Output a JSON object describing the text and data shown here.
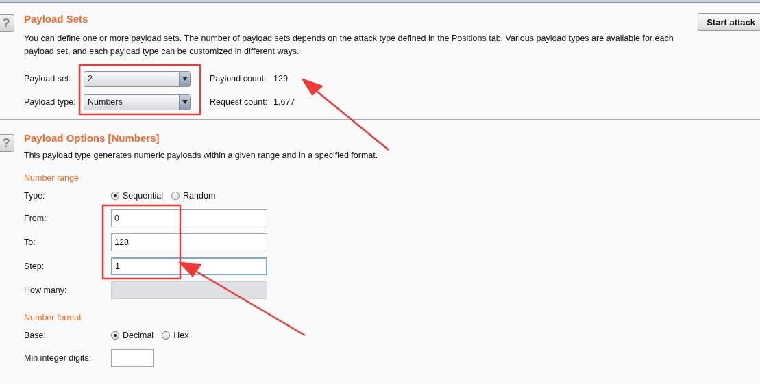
{
  "payload_sets": {
    "help_icon": "?",
    "title": "Payload Sets",
    "description": "You can define one or more payload sets. The number of payload sets depends on the attack type defined in the Positions tab. Various payload types are available for each payload set, and each payload type can be customized in different ways.",
    "start_button": "Start attack",
    "rows": [
      {
        "label": "Payload set:",
        "value": "2",
        "count_label": "Payload count:",
        "count": "129"
      },
      {
        "label": "Payload type:",
        "value": "Numbers",
        "count_label": "Request count:",
        "count": "1,677"
      }
    ]
  },
  "payload_options": {
    "help_icon": "?",
    "title": "Payload Options [Numbers]",
    "description": "This payload type generates numeric payloads within a given range and in a specified format.",
    "groups": [
      {
        "heading": "Number range",
        "rows": [
          {
            "kind": "radio",
            "label": "Type:",
            "options": [
              {
                "label": "Sequential",
                "selected": true
              },
              {
                "label": "Random",
                "selected": false
              }
            ]
          },
          {
            "kind": "input",
            "label": "From:",
            "value": "0",
            "focused": false,
            "disabled": false
          },
          {
            "kind": "input",
            "label": "To:",
            "value": "128",
            "focused": false,
            "disabled": false
          },
          {
            "kind": "input",
            "label": "Step:",
            "value": "1",
            "focused": true,
            "disabled": false
          },
          {
            "kind": "input",
            "label": "How many:",
            "focused": false,
            "disabled": true
          }
        ]
      },
      {
        "heading": "Number format",
        "rows": [
          {
            "kind": "radio",
            "label": "Base:",
            "options": [
              {
                "label": "Decimal",
                "selected": true
              },
              {
                "label": "Hex",
                "selected": false
              }
            ]
          },
          {
            "kind": "short_input",
            "label": "Min integer digits:",
            "focused": false,
            "disabled": false
          }
        ]
      }
    ]
  }
}
